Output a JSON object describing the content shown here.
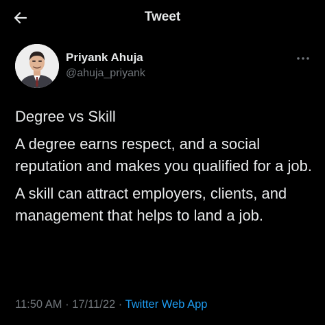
{
  "header": {
    "title": "Tweet"
  },
  "author": {
    "name": "Priyank Ahuja",
    "handle": "@ahuja_priyank"
  },
  "tweet": {
    "paragraphs": [
      "Degree vs Skill",
      "A degree earns respect, and a social reputation and makes you qualified for a job.",
      "A skill can attract employers, clients, and management that helps to land a job."
    ]
  },
  "meta": {
    "time": "11:50 AM",
    "separator": "·",
    "date": "17/11/22",
    "source": "Twitter Web App"
  },
  "colors": {
    "background": "#000000",
    "text": "#e7e9ea",
    "secondary": "#71767b",
    "link": "#1d9bf0"
  },
  "icons": {
    "back": "arrow-left-icon",
    "more": "more-horizontal-icon"
  }
}
